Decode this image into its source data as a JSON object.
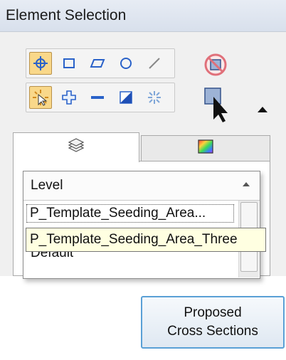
{
  "window": {
    "title": "Element Selection"
  },
  "tools": {
    "row1": [
      "individual-select-icon",
      "block-select-icon",
      "shape-select-icon",
      "circle-select-icon",
      "line-select-icon"
    ],
    "row2": [
      "new-selection-icon",
      "add-selection-icon",
      "subtract-selection-icon",
      "invert-selection-icon",
      "clear-selection-icon"
    ],
    "clear_icon": "clear-selection-icon",
    "select_all_icon": "select-all-icon"
  },
  "tabs": [
    {
      "icon": "layers-icon"
    },
    {
      "icon": "color-icon"
    }
  ],
  "list": {
    "header": "Level",
    "items": [
      "P_Template_Seeding_Area...",
      "Default"
    ]
  },
  "tooltip": {
    "text": "P_Template_Seeding_Area_Three"
  },
  "button": {
    "line1": "Proposed",
    "line2": "Cross Sections"
  },
  "colors": {
    "accent": "#5aa0d6",
    "active_tool": "#f9d88a",
    "tooltip_bg": "#ffffe1"
  }
}
